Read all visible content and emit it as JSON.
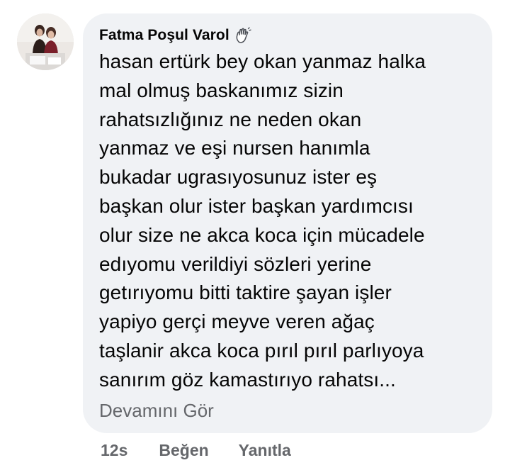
{
  "comment": {
    "author": "Fatma Poşul Varol",
    "author_badge_icon": "waving-hand-icon",
    "text_lines": [
      "hasan ertürk bey okan yanmaz halka",
      "mal olmuş baskanımız sizin",
      "rahatsızlığınız ne neden okan",
      "yanmaz ve eşi nursen hanımla",
      "bukadar ugrasıyosunuz ister eş",
      "başkan olur ister başkan yardımcısı",
      "olur size ne akca koca için mücadele",
      "edıyomu verildiyi sözleri yerine",
      "getırıyomu bitti  taktire şayan işler",
      "yapiyo  gerçi meyve veren ağaç",
      "taşlanir akca koca pırıl pırıl parlıyoya",
      "sanırım göz kamastırıyo rahatsı..."
    ],
    "see_more_label": "Devamını Gör"
  },
  "actions": {
    "time": "12s",
    "like_label": "Beğen",
    "reply_label": "Yanıtla"
  },
  "colors": {
    "bubble_bg": "#f0f2f5",
    "primary_text": "#050505",
    "secondary_text": "#65676b"
  }
}
